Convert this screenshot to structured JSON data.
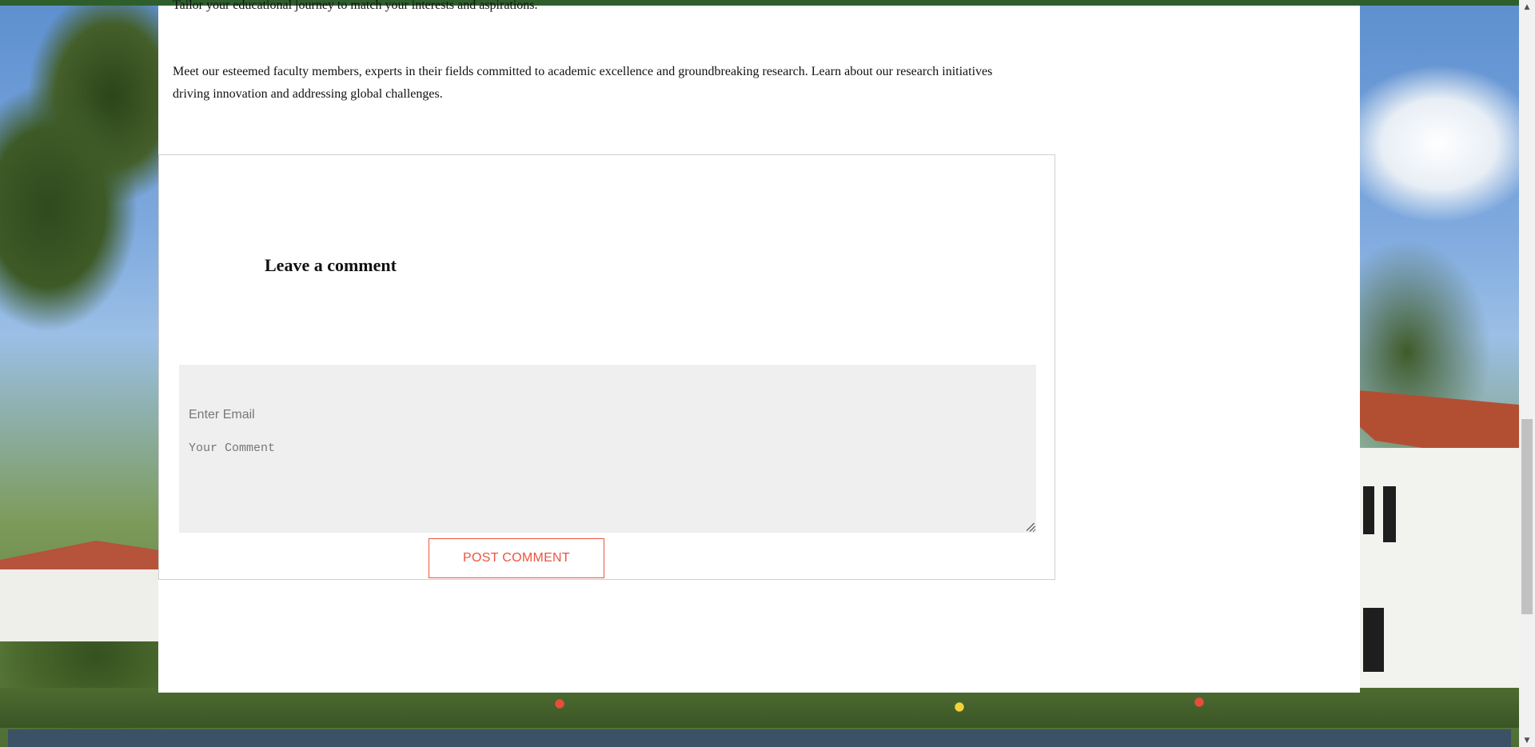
{
  "article": {
    "partial_top_text": "Tailor your educational journey to match your interests and aspirations.",
    "faculty_paragraph": "Meet our esteemed faculty members, experts in their fields committed to academic excellence and groundbreaking research. Learn about our research initiatives driving innovation and addressing global challenges."
  },
  "comment_form": {
    "heading": "Leave a comment",
    "email_placeholder": "Enter Email",
    "comment_placeholder": "Your Comment",
    "submit_label": "POST COMMENT"
  },
  "scrollbar": {
    "up_icon": "▲",
    "down_icon": "▼"
  },
  "colors": {
    "accent": "#e9553f",
    "top_strip": "#2e5e2c",
    "form_background": "#efefef"
  }
}
